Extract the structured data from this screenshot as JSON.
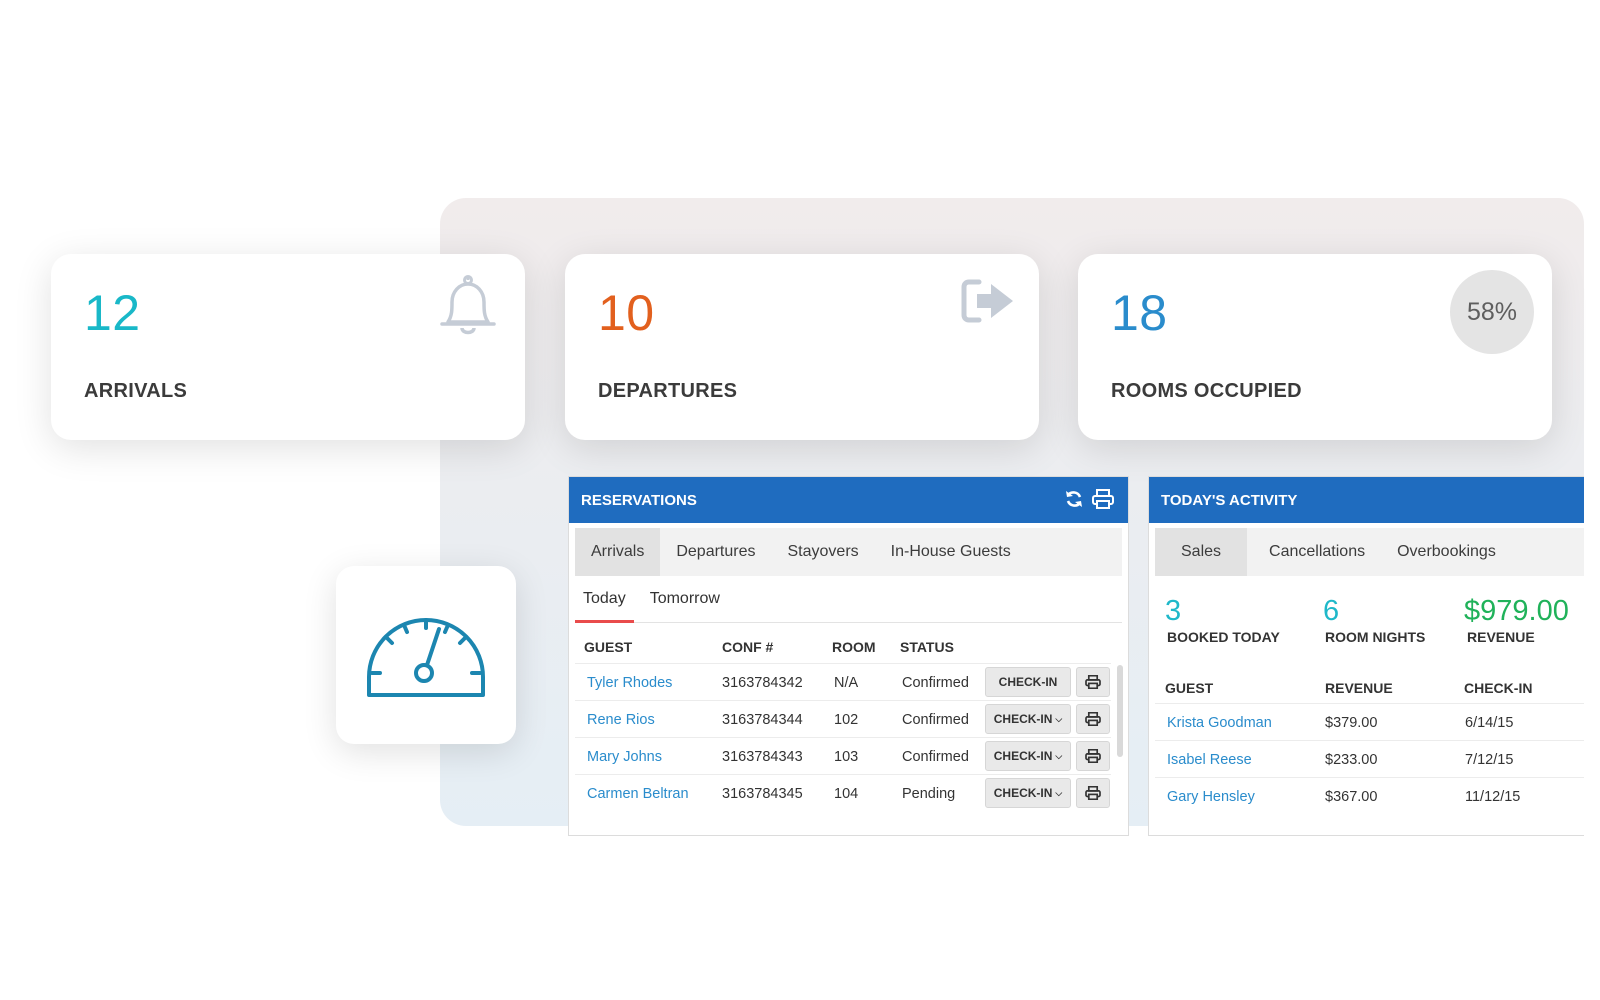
{
  "stats": {
    "arrivals": {
      "value": "12",
      "label": "ARRIVALS",
      "color": "#19b8c8",
      "icon": "bell-icon"
    },
    "departures": {
      "value": "10",
      "label": "DEPARTURES",
      "color": "#e2601e",
      "icon": "sign-out-icon"
    },
    "rooms": {
      "value": "18",
      "label": "ROOMS OCCUPIED",
      "color": "#2a8ccc",
      "occupancy": "58%"
    }
  },
  "gauge": {
    "icon": "speedometer-icon",
    "color": "#1c86b0"
  },
  "reservations": {
    "title": "RESERVATIONS",
    "header_color": "#1f6cbf",
    "tabs": [
      "Arrivals",
      "Departures",
      "Stayovers",
      "In-House Guests"
    ],
    "subtabs": [
      "Today",
      "Tomorrow"
    ],
    "columns": [
      "GUEST",
      "CONF #",
      "ROOM",
      "STATUS"
    ],
    "rows": [
      {
        "guest": "Tyler Rhodes",
        "conf": "3163784342",
        "room": "N/A",
        "status": "Confirmed",
        "action": "CHECK-IN"
      },
      {
        "guest": "Rene Rios",
        "conf": "3163784344",
        "room": "102",
        "status": "Confirmed",
        "action": "CHECK-IN"
      },
      {
        "guest": "Mary Johns",
        "conf": "3163784343",
        "room": "103",
        "status": "Confirmed",
        "action": "CHECK-IN"
      },
      {
        "guest": "Carmen Beltran",
        "conf": "3163784345",
        "room": "104",
        "status": "Pending",
        "action": "CHECK-IN"
      }
    ]
  },
  "activity": {
    "title": "TODAY'S ACTIVITY",
    "tabs": [
      "Sales",
      "Cancellations",
      "Overbookings"
    ],
    "summary": [
      {
        "value": "3",
        "label": "BOOKED TODAY"
      },
      {
        "value": "6",
        "label": "ROOM NIGHTS"
      },
      {
        "value": "$979.00",
        "label": "REVENUE"
      }
    ],
    "columns": [
      "GUEST",
      "REVENUE",
      "CHECK-IN"
    ],
    "rows": [
      {
        "guest": "Krista Goodman",
        "revenue": "$379.00",
        "checkin": "6/14/15"
      },
      {
        "guest": "Isabel Reese",
        "revenue": "$233.00",
        "checkin": "7/12/15"
      },
      {
        "guest": "Gary Hensley",
        "revenue": "$367.00",
        "checkin": "11/12/15"
      }
    ]
  }
}
